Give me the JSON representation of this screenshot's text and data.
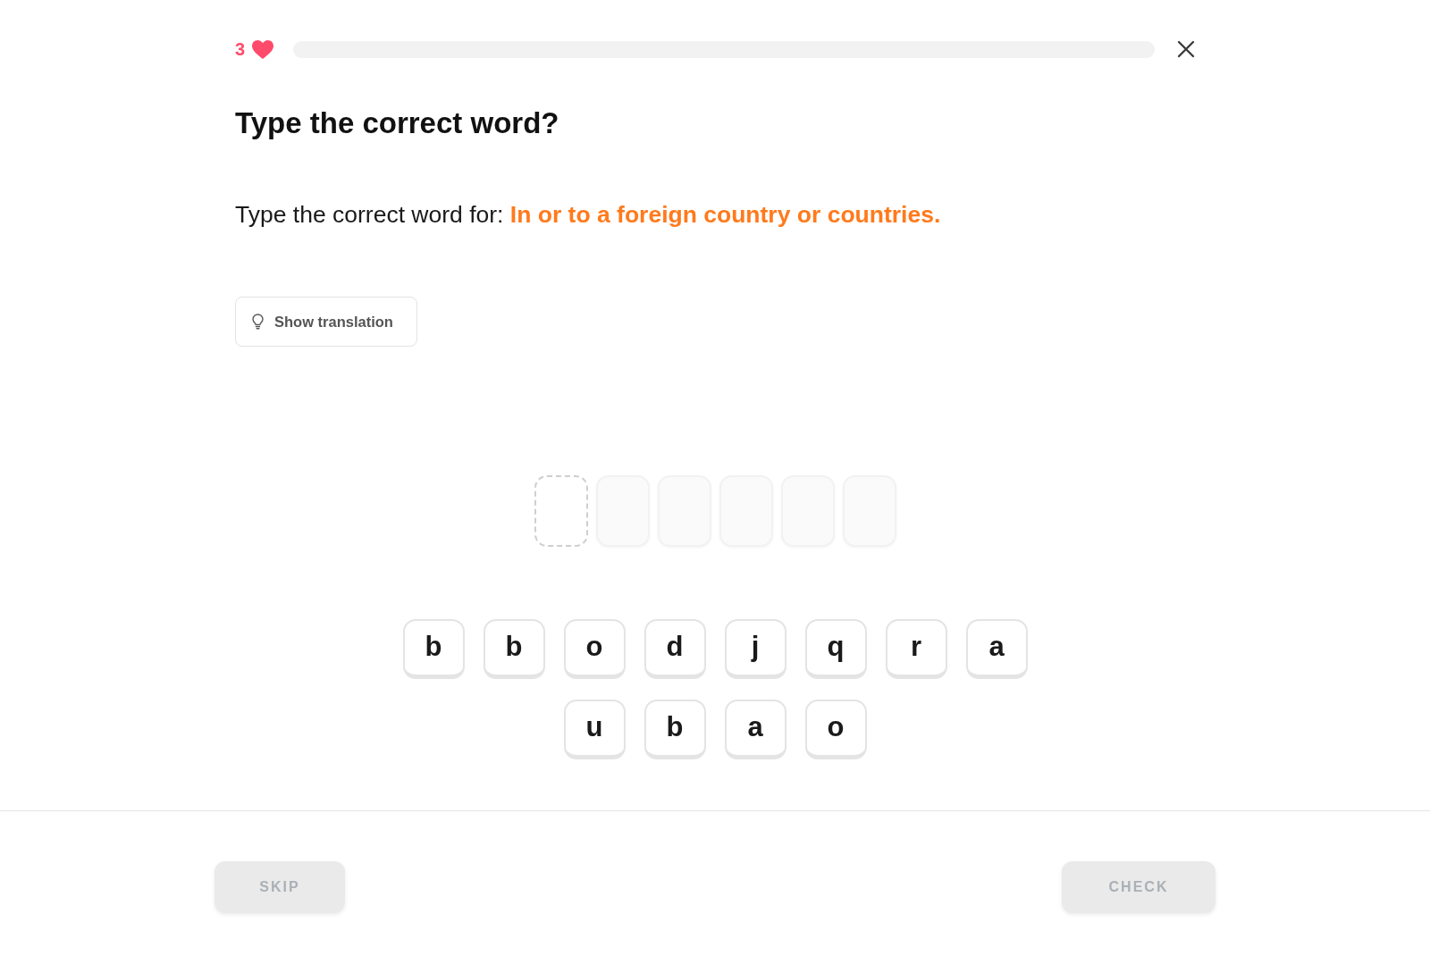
{
  "header": {
    "lives": "3",
    "progress": {
      "level": 0
    }
  },
  "question": {
    "title": "Type the correct word?",
    "prompt": "Type the correct word for: **In or to a foreign country or countries.**"
  },
  "hint_button": {
    "label": "Show translation"
  },
  "answer_slots": [
    {
      "selected": true
    },
    {
      "selected": false
    },
    {
      "selected": false
    },
    {
      "selected": false
    },
    {
      "selected": false
    },
    {
      "selected": false
    }
  ],
  "letter_keys": [
    {
      "label": "b"
    },
    {
      "label": "b"
    },
    {
      "label": "o"
    },
    {
      "label": "d"
    },
    {
      "label": "j"
    },
    {
      "label": "q"
    },
    {
      "label": "r"
    },
    {
      "label": "a"
    },
    {
      "label": "u"
    },
    {
      "label": "b"
    },
    {
      "label": "a"
    },
    {
      "label": "o"
    }
  ],
  "footer": {
    "buttons": [
      {
        "label": "SKIP",
        "disabled": true
      },
      {
        "label": "CHECK",
        "disabled": true
      }
    ]
  }
}
